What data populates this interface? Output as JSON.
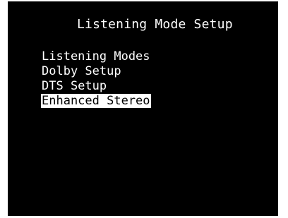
{
  "screen": {
    "title": "Listening Mode Setup",
    "menu": [
      {
        "label": "Listening Modes",
        "selected": false
      },
      {
        "label": "Dolby Setup",
        "selected": false
      },
      {
        "label": "DTS Setup",
        "selected": false
      },
      {
        "label": "Enhanced Stereo",
        "selected": true
      }
    ]
  },
  "colors": {
    "background": "#000000",
    "text": "#ffffff",
    "highlight": "#ffffff"
  }
}
